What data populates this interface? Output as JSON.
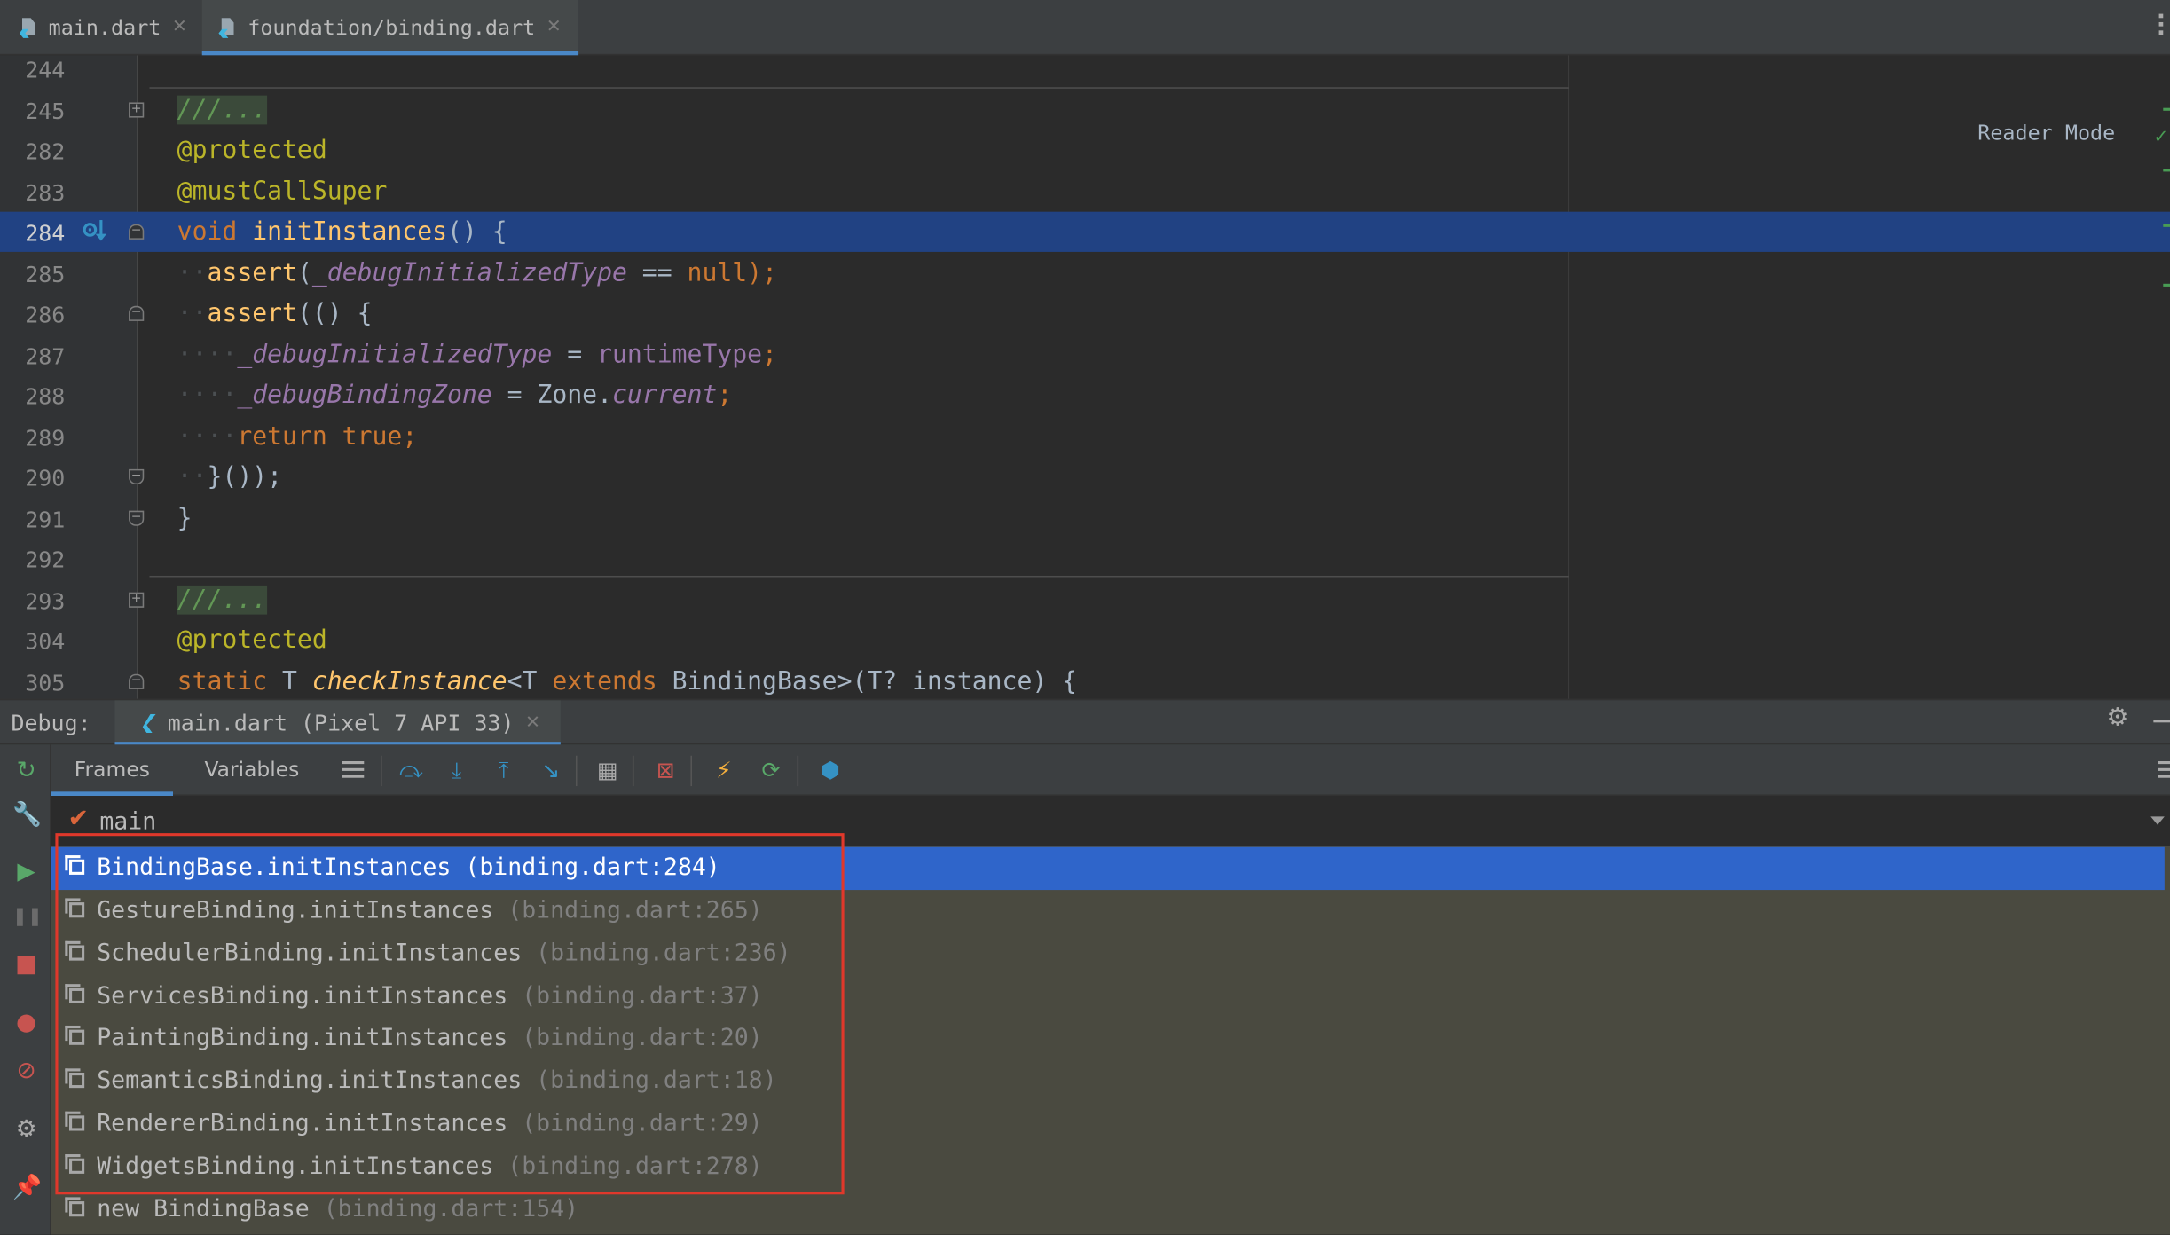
{
  "tabs": [
    {
      "label": "main.dart",
      "icon": "dart-file-icon",
      "active": false
    },
    {
      "label": "foundation/binding.dart",
      "icon": "dart-library-file-icon",
      "active": true
    }
  ],
  "editor": {
    "reader_mode": "Reader Mode",
    "lines": [
      {
        "n": "244"
      },
      {
        "n": "245"
      },
      {
        "n": "282"
      },
      {
        "n": "283"
      },
      {
        "n": "284"
      },
      {
        "n": "285"
      },
      {
        "n": "286"
      },
      {
        "n": "287"
      },
      {
        "n": "288"
      },
      {
        "n": "289"
      },
      {
        "n": "290"
      },
      {
        "n": "291"
      },
      {
        "n": "292"
      },
      {
        "n": "293"
      },
      {
        "n": "304"
      },
      {
        "n": "305"
      }
    ],
    "tokens": {
      "doc1": "///...",
      "protected": "@protected",
      "mustcallsuper": "@mustCallSuper",
      "void": "void",
      "initinstances": "initInstances",
      "paren_brace": "() {",
      "assert": "assert",
      "open": "(",
      "debug_type": "_debugInitializedType",
      "eq_null_op": " == ",
      "null": "null",
      "close_semi": ");",
      "assert2_tail": "(() {",
      "assign": " = ",
      "runtime": "runtimeType",
      "semi": ";",
      "debug_zone": "_debugBindingZone",
      "zone": "Zone.",
      "current": "current",
      "return": "return",
      "true": "true",
      "close_call": "}());",
      "close_brace": "}",
      "doc2": "///...",
      "static": "static",
      "t_ret": " T ",
      "checkinstance": "checkInstance",
      "generic_open": "<T ",
      "extends": "extends",
      "generic_close": " BindingBase>(T? instance) {"
    }
  },
  "debug": {
    "label": "Debug:",
    "session": "main.dart (Pixel 7 API 33)",
    "tabs": [
      "Frames",
      "Variables"
    ],
    "thread": "main",
    "frames": [
      {
        "method": "BindingBase.initInstances",
        "location": "(binding.dart:284)",
        "selected": true
      },
      {
        "method": "GestureBinding.initInstances",
        "location": "(binding.dart:265)"
      },
      {
        "method": "SchedulerBinding.initInstances",
        "location": "(binding.dart:236)"
      },
      {
        "method": "ServicesBinding.initInstances",
        "location": "(binding.dart:37)"
      },
      {
        "method": "PaintingBinding.initInstances",
        "location": "(binding.dart:20)"
      },
      {
        "method": "SemanticsBinding.initInstances",
        "location": "(binding.dart:18)"
      },
      {
        "method": "RendererBinding.initInstances",
        "location": "(binding.dart:29)"
      },
      {
        "method": "WidgetsBinding.initInstances",
        "location": "(binding.dart:278)"
      },
      {
        "method": "new BindingBase",
        "location": "(binding.dart:154)"
      }
    ],
    "toolbar_icons": [
      "menu-icon",
      "step-over-icon",
      "step-into-icon",
      "step-out-icon",
      "run-to-cursor-icon",
      "evaluate-expression-icon",
      "clear-breakpoints-icon",
      "hot-reload-icon",
      "hot-restart-icon",
      "flutter-inspector-icon"
    ],
    "sidebar_icons": [
      "rerun-icon",
      "wrench-icon",
      "resume-icon",
      "pause-icon",
      "stop-icon",
      "view-breakpoints-icon",
      "mute-breakpoints-icon",
      "settings-icon",
      "pin-icon"
    ]
  },
  "colors": {
    "selection": "#2f65ca",
    "editor_highlight": "#214283",
    "annotation_box": "#e0382b",
    "keyword": "#cc7832",
    "function": "#ffc66d",
    "field": "#9876aa"
  }
}
